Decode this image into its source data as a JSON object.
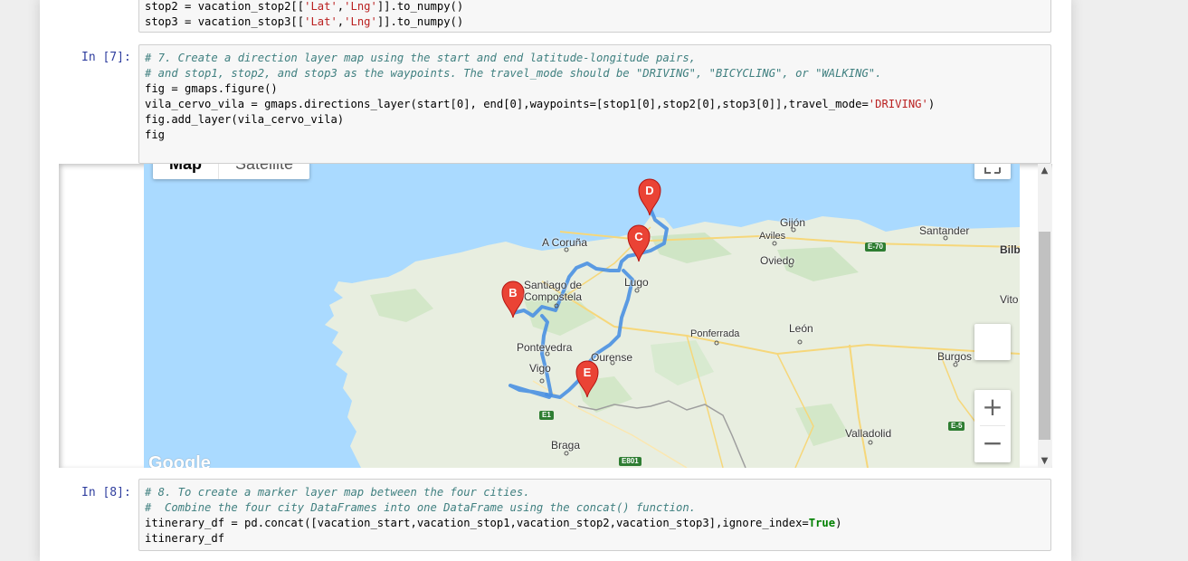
{
  "cells": {
    "prev": {
      "lines": [
        {
          "pre": "stop2 = vacation_stop2[[",
          "s1": "'Lat'",
          "mid": ",",
          "s2": "'Lng'",
          "post": "]].to_numpy()"
        },
        {
          "pre": "stop3 = vacation_stop3[[",
          "s1": "'Lat'",
          "mid": ",",
          "s2": "'Lng'",
          "post": "]].to_numpy()"
        }
      ]
    },
    "cell7": {
      "prompt": "In [7]:",
      "comment1": "# 7. Create a direction layer map using the start and end latitude-longitude pairs,",
      "comment2": "# and stop1, stop2, and stop3 as the waypoints. The travel_mode should be \"DRIVING\", \"BICYCLING\", or \"WALKING\".",
      "line3": "fig = gmaps.figure()",
      "line4_pre": "vila_cervo_vila = gmaps.directions_layer(start[0], end[0],waypoints=[stop1[0],stop2[0],stop3[0]],travel_mode=",
      "line4_str": "'DRIVING'",
      "line4_post": ")",
      "line5": "fig.add_layer(vila_cervo_vila)",
      "line6": "fig"
    },
    "cell8": {
      "prompt": "In [8]:",
      "comment1": "# 8. To create a marker layer map between the four cities.",
      "comment2": "#  Combine the four city DataFrames into one DataFrame using the concat() function.",
      "line3_pre": "itinerary_df = pd.concat([vacation_start,vacation_stop1,vacation_stop2,vacation_stop3],ignore_index=",
      "line3_kw": "True",
      "line3_post": ")",
      "line4": "itinerary_df"
    }
  },
  "map": {
    "map_type_buttons": [
      "Map",
      "Satellite"
    ],
    "active_map_type": "Map",
    "zoom_in": "+",
    "zoom_out": "−",
    "google_logo": "Google",
    "colors": {
      "water": "#aadaff",
      "land": "#e8eee0",
      "route": "#4a90e2",
      "marker": "#ea4335",
      "road": "#f5d76e"
    },
    "markers": [
      "B",
      "C",
      "D",
      "E"
    ],
    "cities": {
      "acoruna": "A Coruña",
      "santiago1": "Santiago de",
      "santiago2": "Compostela",
      "lugo": "Lugo",
      "pontevedra": "Pontevedra",
      "vigo": "Vigo",
      "ourense": "Ourense",
      "braga": "Braga",
      "gijon": "Gijón",
      "aviles": "Aviles",
      "oviedo": "Oviedo",
      "santander": "Santander",
      "bilbao": "Bilb",
      "vitoria": "Vito",
      "leon": "León",
      "ponferrada": "Ponferrada",
      "burgos": "Burgos",
      "valladolid": "Valladolid"
    },
    "road_shields": [
      "E-70",
      "E1",
      "E-5",
      "E801"
    ]
  }
}
